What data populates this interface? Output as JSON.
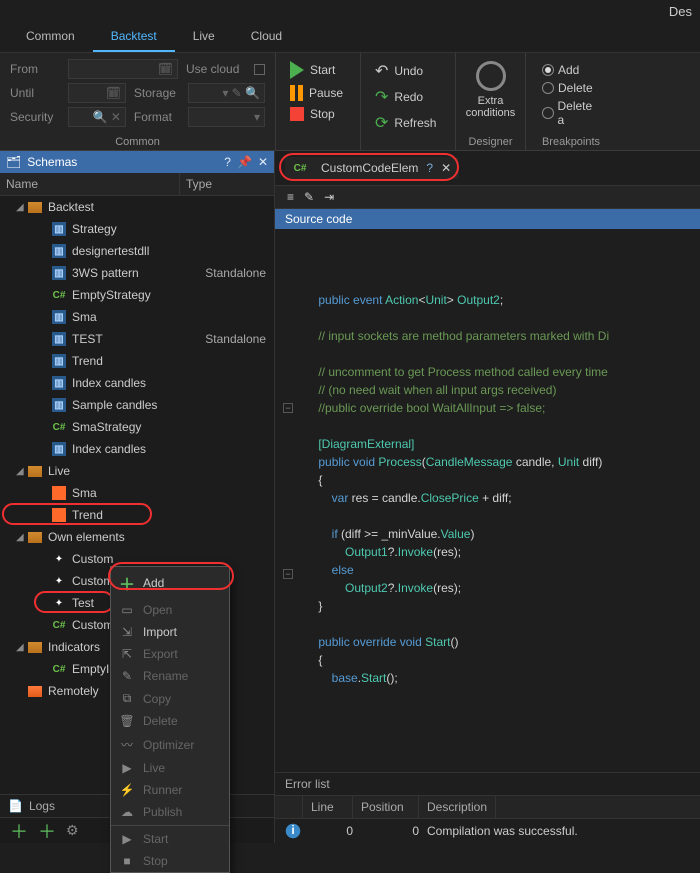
{
  "titlebar": "Des",
  "main_tabs": {
    "common": "Common",
    "backtest": "Backtest",
    "live": "Live",
    "cloud": "Cloud"
  },
  "ribbon": {
    "form": {
      "from": "From",
      "until": "Until",
      "security": "Security",
      "usecloud": "Use cloud",
      "storage": "Storage",
      "format": "Format"
    },
    "group1_label": "Common",
    "start": "Start",
    "pause": "Pause",
    "stop": "Stop",
    "undo": "Undo",
    "redo": "Redo",
    "refresh": "Refresh",
    "extra": "Extra\nconditions",
    "add": "Add",
    "delete": "Delete",
    "deletea": "Delete a",
    "group_designer": "Designer",
    "group_breakpoints": "Breakpoints"
  },
  "schemas": {
    "title": "Schemas",
    "col_name": "Name",
    "col_type": "Type",
    "backtest": "Backtest",
    "items_backtest": [
      "Strategy",
      "designertestdll",
      "3WS pattern",
      "EmptyStrategy",
      "Sma",
      "TEST",
      "Trend",
      "Index candles",
      "Sample candles",
      "SmaStrategy",
      "Index candles"
    ],
    "types_backtest": {
      "2": "Standalone",
      "5": "Standalone"
    },
    "live": "Live",
    "items_live": [
      "Sma",
      "Trend"
    ],
    "own": "Own elements",
    "items_own": [
      "Custom",
      "Custom",
      "Test",
      "Custom"
    ],
    "indicators": "Indicators",
    "items_indicators": [
      "EmptyIn"
    ],
    "remotely": "Remotely"
  },
  "logs_label": "Logs",
  "editor": {
    "tab_label": "CustomCodeElem",
    "source_label": "Source code"
  },
  "code_lines": [
    "    public event Action<Unit> Output2;",
    "",
    "    // input sockets are method parameters marked with Di",
    "",
    "    // uncomment to get Process method called every time ",
    "    // (no need wait when all input args received)",
    "    //public override bool WaitAllInput => false;",
    "",
    "    [DiagramExternal]",
    "    public void Process(CandleMessage candle, Unit diff)",
    "    {",
    "        var res = candle.ClosePrice + diff;",
    "",
    "        if (diff >= _minValue.Value)",
    "            Output1?.Invoke(res);",
    "        else",
    "            Output2?.Invoke(res);",
    "    }",
    "",
    "    public override void Start()",
    "    {",
    "        base.Start();"
  ],
  "errors": {
    "title": "Error list",
    "col_line": "Line",
    "col_pos": "Position",
    "col_desc": "Description",
    "row": {
      "line": "0",
      "pos": "0",
      "desc": "Compilation was successful."
    }
  },
  "context": {
    "add": "Add",
    "open": "Open",
    "import": "Import",
    "export": "Export",
    "rename": "Rename",
    "copy": "Copy",
    "delete": "Delete",
    "optimizer": "Optimizer",
    "live": "Live",
    "runner": "Runner",
    "publish": "Publish",
    "start": "Start",
    "stop": "Stop"
  }
}
